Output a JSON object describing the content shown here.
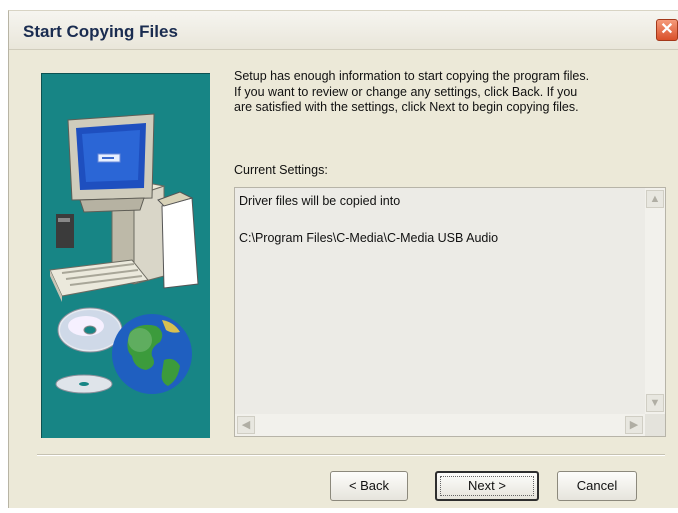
{
  "window": {
    "title": "Start Copying Files",
    "close_label": "✕"
  },
  "info": {
    "lines": [
      "Setup has enough information to start copying the program files.",
      "If you want to review or change any settings, click Back.  If you",
      "are satisfied with the settings, click Next to begin copying files."
    ]
  },
  "settings": {
    "label": "Current Settings:",
    "lines": [
      "Driver files will be copied into",
      "C:\\Program Files\\C-Media\\C-Media USB Audio"
    ]
  },
  "scrollbars": {
    "up_arrow": "▲",
    "down_arrow": "▼",
    "left_arrow": "◀",
    "right_arrow": "▶"
  },
  "buttons": {
    "back": "< Back",
    "next": "Next >",
    "cancel": "Cancel"
  },
  "colors": {
    "art_background": "#178585",
    "window_background": "#ece9d8",
    "close_button": "#d9502a"
  },
  "icons": [
    "computer-icon",
    "cd-disc-icon",
    "globe-icon"
  ]
}
